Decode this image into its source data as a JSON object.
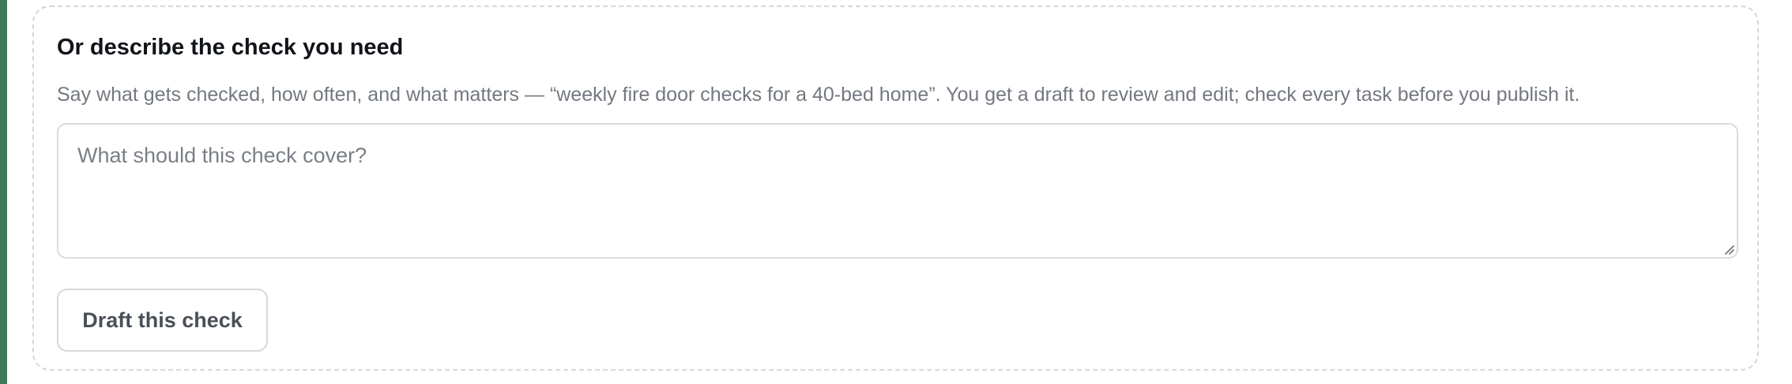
{
  "check_describer": {
    "title": "Or describe the check you need",
    "description": "Say what gets checked, how often, and what matters — “weekly fire door checks for a 40-bed home”. You get a draft to review and edit; check every task before you publish it.",
    "input": {
      "placeholder": "What should this check cover?",
      "value": ""
    },
    "draft_button_label": "Draft this check"
  },
  "colors": {
    "accent_bar": "#3f7a5a",
    "card_border": "#d4d6da",
    "title_text": "#111418",
    "muted_text": "#737880"
  },
  "icons": {
    "resize_handle": "resize-handle-icon"
  }
}
